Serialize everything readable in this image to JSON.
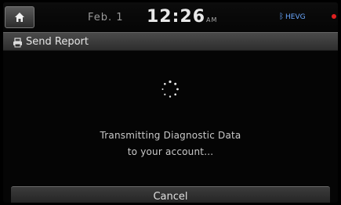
{
  "status_bar": {
    "date": "Feb. 1",
    "time": "12:26",
    "ampm": "AM",
    "status_icons_text": "HEVG",
    "icons": [
      "home-icon",
      "bluetooth-icon",
      "alert-icon"
    ]
  },
  "title_bar": {
    "title": "Send Report",
    "icon": "printer-icon"
  },
  "content": {
    "message_line1": "Transmitting Diagnostic Data",
    "message_line2": "to your account..."
  },
  "actions": {
    "cancel_label": "Cancel"
  },
  "colors": {
    "background": "#050505",
    "text": "#c9c9c9",
    "accent_blue": "#6aa8ff",
    "alert_red": "#e02020"
  }
}
